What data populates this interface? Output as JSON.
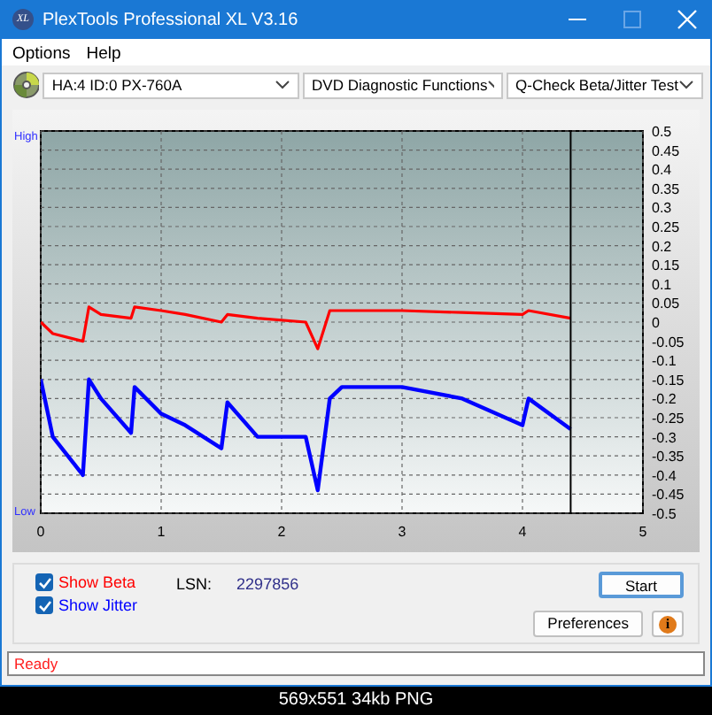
{
  "window": {
    "icon_text": "XL",
    "title": "PlexTools Professional XL V3.16"
  },
  "menu": [
    {
      "label": "Options"
    },
    {
      "label": "Help"
    }
  ],
  "toolbar": {
    "drive": "HA:4 ID:0  PX-760A",
    "function": "DVD Diagnostic Functions",
    "test": "Q-Check Beta/Jitter Test"
  },
  "chart": {
    "high_label": "High",
    "low_label": "Low",
    "chart_data": {
      "type": "line",
      "x": [
        0,
        0.1,
        0.35,
        0.4,
        0.5,
        0.75,
        0.78,
        1.0,
        1.2,
        1.5,
        1.55,
        1.8,
        2.2,
        2.3,
        2.4,
        2.5,
        3.0,
        3.5,
        4.0,
        4.05,
        4.4
      ],
      "series": [
        {
          "color": "#ff0000",
          "values": [
            0.0,
            -0.03,
            -0.05,
            0.04,
            0.02,
            0.01,
            0.04,
            0.03,
            0.02,
            0.0,
            0.02,
            0.01,
            0.0,
            -0.07,
            0.03,
            0.03,
            0.03,
            0.025,
            0.02,
            0.03,
            0.01
          ]
        },
        {
          "color": "#0000ff",
          "values": [
            -0.15,
            -0.3,
            -0.4,
            -0.15,
            -0.2,
            -0.29,
            -0.17,
            -0.24,
            -0.27,
            -0.33,
            -0.21,
            -0.3,
            -0.3,
            -0.44,
            -0.2,
            -0.17,
            -0.17,
            -0.2,
            -0.27,
            -0.2,
            -0.28
          ]
        }
      ],
      "xlim": [
        0,
        5
      ],
      "ylim": [
        -0.5,
        0.5
      ],
      "xticks": [
        0,
        1,
        2,
        3,
        4,
        5
      ],
      "yticks": [
        0.5,
        0.45,
        0.4,
        0.35,
        0.3,
        0.25,
        0.2,
        0.15,
        0.1,
        0.05,
        0,
        -0.05,
        -0.1,
        -0.15,
        -0.2,
        -0.25,
        -0.3,
        -0.35,
        -0.4,
        -0.45,
        -0.5
      ],
      "grid": true,
      "ref_lines": [
        {
          "axis": "x",
          "value": 4.4
        }
      ]
    }
  },
  "controls": {
    "checkboxes": [
      {
        "label": "Show Beta",
        "checked": true,
        "color": "#ff0000"
      },
      {
        "label": "Show Jitter",
        "checked": true,
        "color": "#0000ff"
      }
    ],
    "lsn_label": "LSN:",
    "lsn_value": "2297856",
    "start_button": "Start",
    "preferences_button": "Preferences",
    "info_button": "i"
  },
  "status_bar": {
    "text": "Ready"
  },
  "caption": "569x551 34kb PNG"
}
